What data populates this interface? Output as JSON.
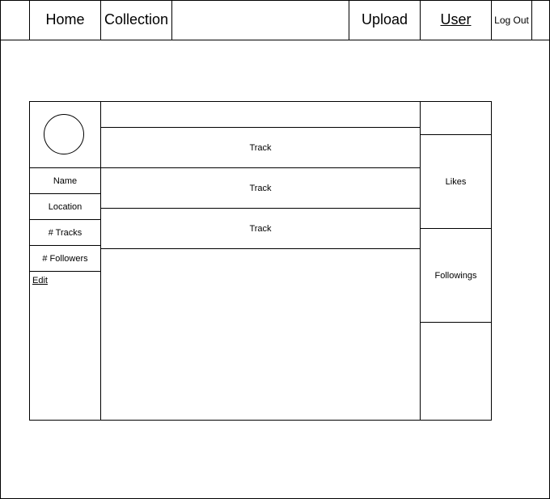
{
  "nav": {
    "home_label": "Home",
    "collection_label": "Collection",
    "upload_label": "Upload",
    "user_label": "User",
    "logout_label": "Log Out"
  },
  "profile": {
    "name_label": "Name",
    "location_label": "Location",
    "tracks_label": "# Tracks",
    "followers_label": "# Followers",
    "edit_label": "Edit"
  },
  "tracks": [
    {
      "label": "Track"
    },
    {
      "label": "Track"
    },
    {
      "label": "Track"
    }
  ],
  "right_panel": {
    "likes_label": "Likes",
    "followings_label": "Followings"
  }
}
